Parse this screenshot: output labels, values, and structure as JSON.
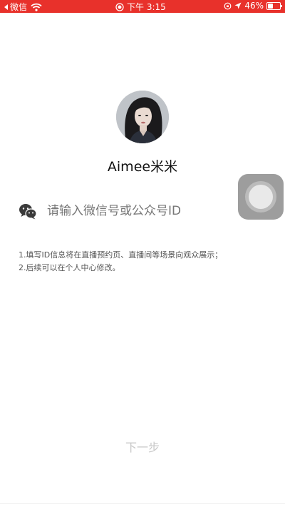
{
  "status_bar": {
    "carrier": "微信",
    "time": "下午 3:15",
    "battery": "46%",
    "battery_level": 0.46,
    "background_color": "#e8312b"
  },
  "profile": {
    "username": "Aimee米米"
  },
  "id_field": {
    "placeholder": "请输入微信号或公众号ID",
    "value": "",
    "icon": "wechat-icon"
  },
  "notes": [
    "1.填写ID信息将在直播预约页、直播间等场景向观众展示；",
    "2.后续可以在个人中心修改。"
  ],
  "next_button": {
    "label": "下一步",
    "color": "#c8c8c8"
  }
}
